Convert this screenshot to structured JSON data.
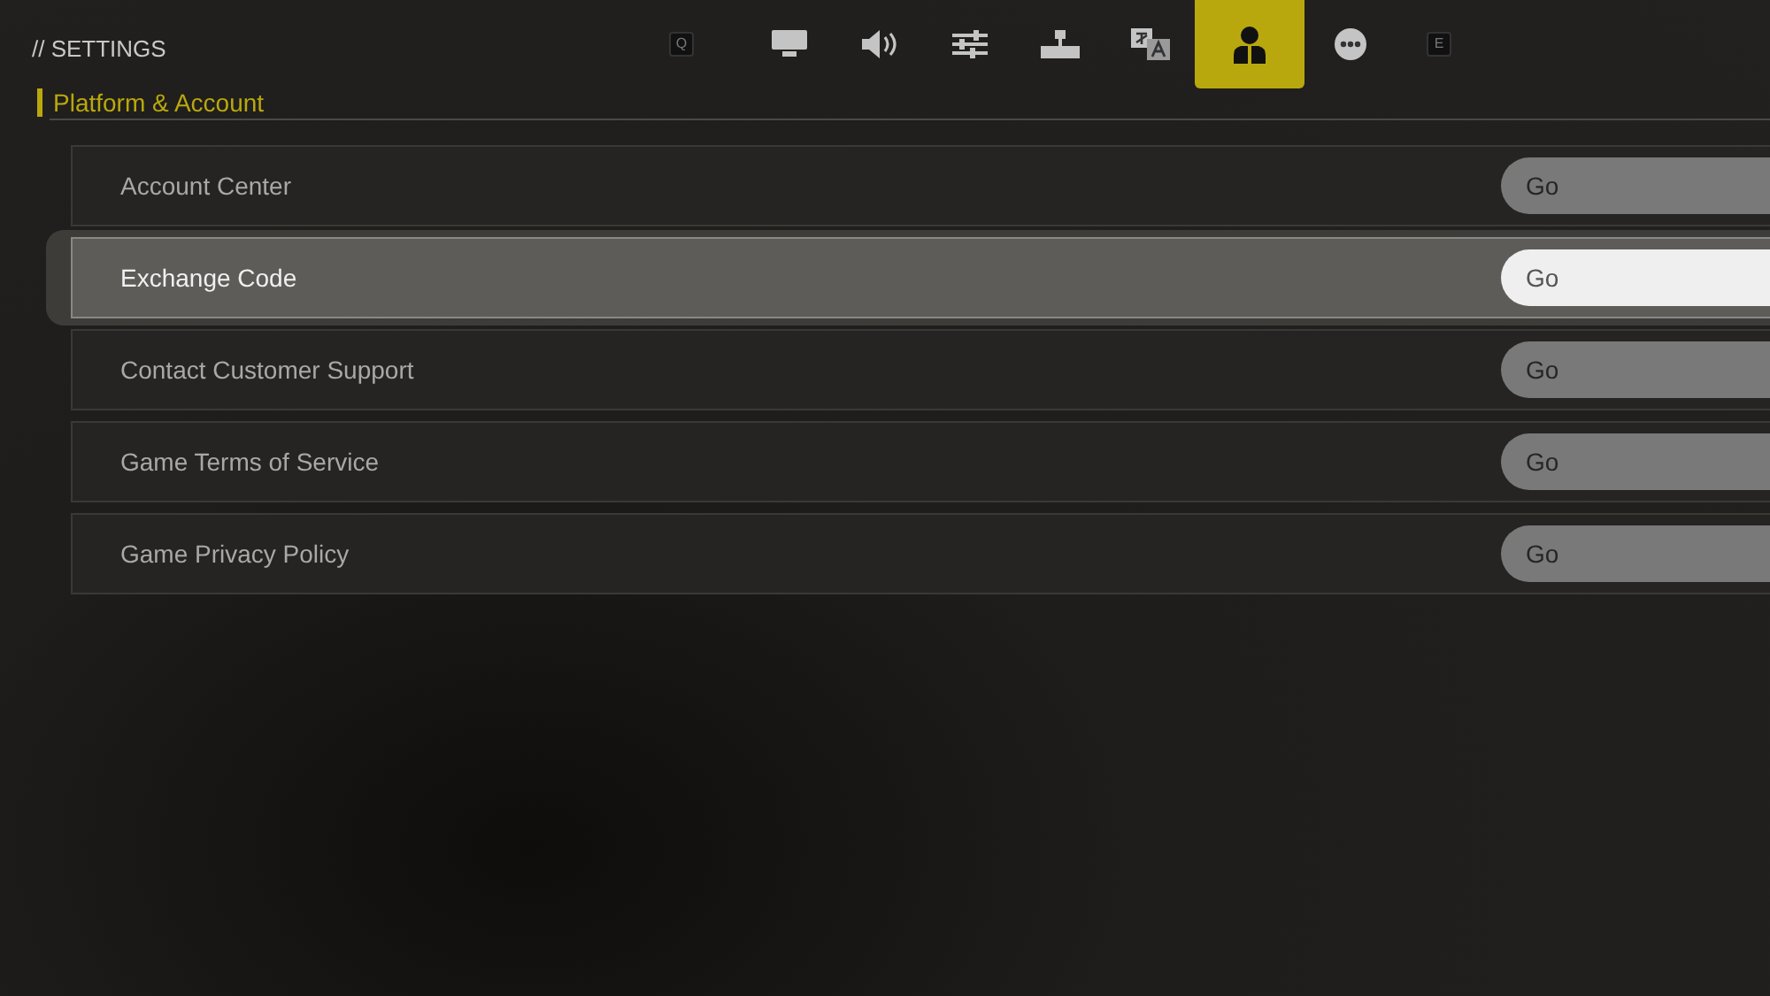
{
  "header": {
    "title": "// SETTINGS"
  },
  "tab_bar": {
    "prev_key": "Q",
    "next_key": "E",
    "tabs": [
      {
        "kind": "display",
        "selected": false
      },
      {
        "kind": "sound",
        "selected": false
      },
      {
        "kind": "controls",
        "selected": false
      },
      {
        "kind": "network",
        "selected": false
      },
      {
        "kind": "language",
        "selected": false
      },
      {
        "kind": "account",
        "selected": true
      },
      {
        "kind": "more",
        "selected": false
      }
    ]
  },
  "section": {
    "title": "Platform & Account"
  },
  "rows": [
    {
      "label": "Account Center",
      "button": "Go",
      "selected": false
    },
    {
      "label": "Exchange Code",
      "button": "Go",
      "selected": true
    },
    {
      "label": "Contact Customer Support",
      "button": "Go",
      "selected": false
    },
    {
      "label": "Game Terms of Service",
      "button": "Go",
      "selected": false
    },
    {
      "label": "Game Privacy Policy",
      "button": "Go",
      "selected": false
    }
  ]
}
